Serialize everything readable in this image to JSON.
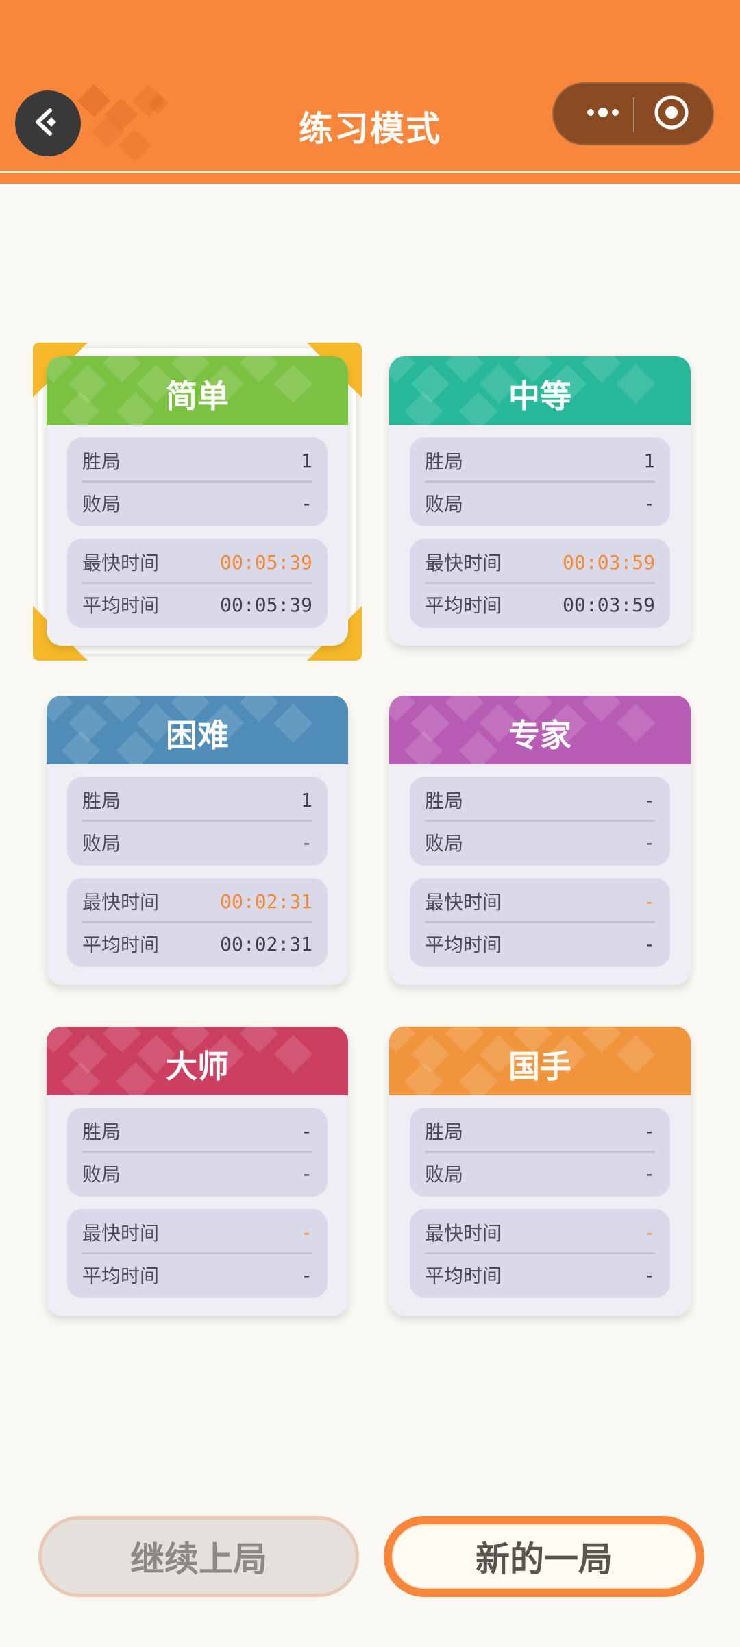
{
  "header": {
    "title": "练习模式",
    "back_icon": "back-arrow-icon",
    "more_icon": "more-dots-icon",
    "close_icon": "target-close-icon",
    "color": "#f8873b"
  },
  "stat_labels": {
    "wins": "胜局",
    "losses": "败局",
    "fastest": "最快时间",
    "average": "平均时间"
  },
  "cards": [
    {
      "title": "简单",
      "color": "#7cc242",
      "wins": "1",
      "losses": "-",
      "fastest": "00:05:39",
      "average": "00:05:39",
      "selected": true
    },
    {
      "title": "中等",
      "color": "#27b89a",
      "wins": "1",
      "losses": "-",
      "fastest": "00:03:59",
      "average": "00:03:59",
      "selected": false
    },
    {
      "title": "困难",
      "color": "#4f8db8",
      "wins": "1",
      "losses": "-",
      "fastest": "00:02:31",
      "average": "00:02:31",
      "selected": false
    },
    {
      "title": "专家",
      "color": "#b85cb5",
      "wins": "-",
      "losses": "-",
      "fastest": "-",
      "average": "-",
      "selected": false
    },
    {
      "title": "大师",
      "color": "#cc3f60",
      "wins": "-",
      "losses": "-",
      "fastest": "-",
      "average": "-",
      "selected": false
    },
    {
      "title": "国手",
      "color": "#f0953c",
      "wins": "-",
      "losses": "-",
      "fastest": "-",
      "average": "-",
      "selected": false
    }
  ],
  "buttons": {
    "continue": "继续上局",
    "new_game": "新的一局"
  },
  "colors": {
    "highlight_time": "#f28a32",
    "selection_corner": "#f5b92a"
  }
}
